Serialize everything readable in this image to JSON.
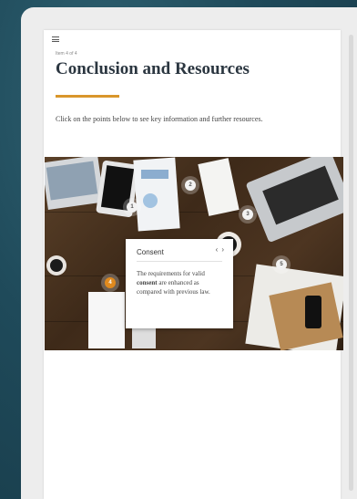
{
  "lesson": {
    "progress": "Item 4 of 4",
    "title": "Conclusion and Resources",
    "intro": "Click on the points below to see key information and further resources."
  },
  "hotspots": [
    {
      "label": "1"
    },
    {
      "label": "2"
    },
    {
      "label": "3"
    },
    {
      "label": "4"
    },
    {
      "label": "5"
    }
  ],
  "popup": {
    "title": "Consent",
    "prev": "‹",
    "next": "›",
    "text_before": "The requirements for valid",
    "text_bold": "consent",
    "text_after": "are enhanced as compared with previous law."
  },
  "colors": {
    "accent": "#d9962b",
    "hotspot_active": "#e08a1e",
    "title": "#2b3640"
  }
}
